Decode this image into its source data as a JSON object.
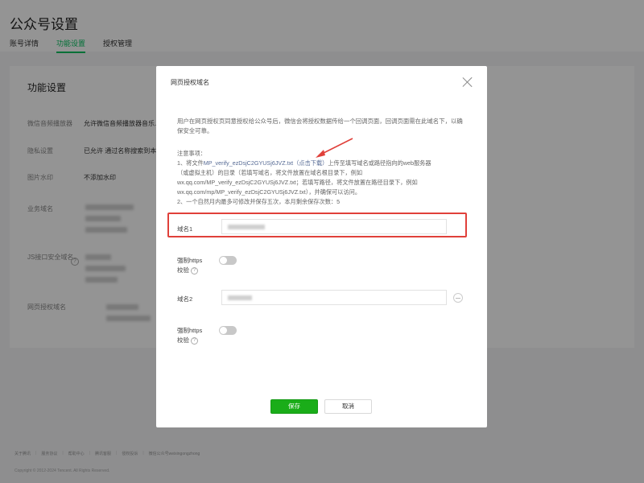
{
  "page": {
    "title": "公众号设置",
    "tabs": [
      {
        "label": "账号详情"
      },
      {
        "label": "功能设置"
      },
      {
        "label": "授权管理"
      }
    ]
  },
  "card": {
    "title": "功能设置",
    "rows": [
      {
        "label": "微信音频播放器",
        "value": "允许微信音频播放器音乐..."
      },
      {
        "label": "隐私设置",
        "value": "已允许 通过名称搜索到本"
      },
      {
        "label": "图片水印",
        "value": "不添加水印"
      },
      {
        "label": "业务域名",
        "value": ""
      },
      {
        "label": "JS接口安全域名",
        "value": ""
      },
      {
        "label": "网页授权域名",
        "value": ""
      }
    ]
  },
  "footer": {
    "links": [
      "关于腾讯",
      "服务协议",
      "帮助中心",
      "腾讯客服",
      "侵权投诉",
      "微信公众号weixingongzhong"
    ],
    "copyright": "Copyright © 2012-2024 Tencent. All Rights Reserved."
  },
  "dialog": {
    "title": "网页授权域名",
    "intro": "用户在网页授权页同意授权给公众号后，微信会将授权数据传给一个回调页面，回调页面需在此域名下，以确保安全可靠。",
    "notes_heading": "注意事项：",
    "note1_prefix": "1、将文件",
    "note1_file": "MP_verify_ezDsjC2GYUSj6JVZ.txt",
    "note1_download": "（点击下载）",
    "note1_suffix": "上传至填写域名或路径指向的web服务器",
    "note1_line2": "（或虚拟主机）的目录（若填写域名，将文件放置在域名根目录下，例如",
    "note1_line3": "wx.qq.com/MP_verify_ezDsjC2GYUSj6JVZ.txt；若填写路径，将文件放置在路径目录下，例如",
    "note1_line4": "wx.qq.com/mp/MP_verify_ezDsjC2GYUSj6JVZ.txt），并确保可以访问。",
    "note2": "2、一个自然月内最多可修改并保存五次，本月剩余保存次数：5",
    "domain1_label": "域名1",
    "https1_label_a": "强制https",
    "https1_label_b": "校验",
    "domain2_label": "域名2",
    "https2_label_a": "强制https",
    "https2_label_b": "校验",
    "save_label": "保存",
    "cancel_label": "取消"
  },
  "colors": {
    "accent": "#07c160",
    "save_button": "#1aad19",
    "link": "#576b95",
    "highlight": "#e0403a"
  },
  "icons": {
    "close": "close-icon",
    "help": "question-icon",
    "remove": "minus-circle-icon"
  }
}
